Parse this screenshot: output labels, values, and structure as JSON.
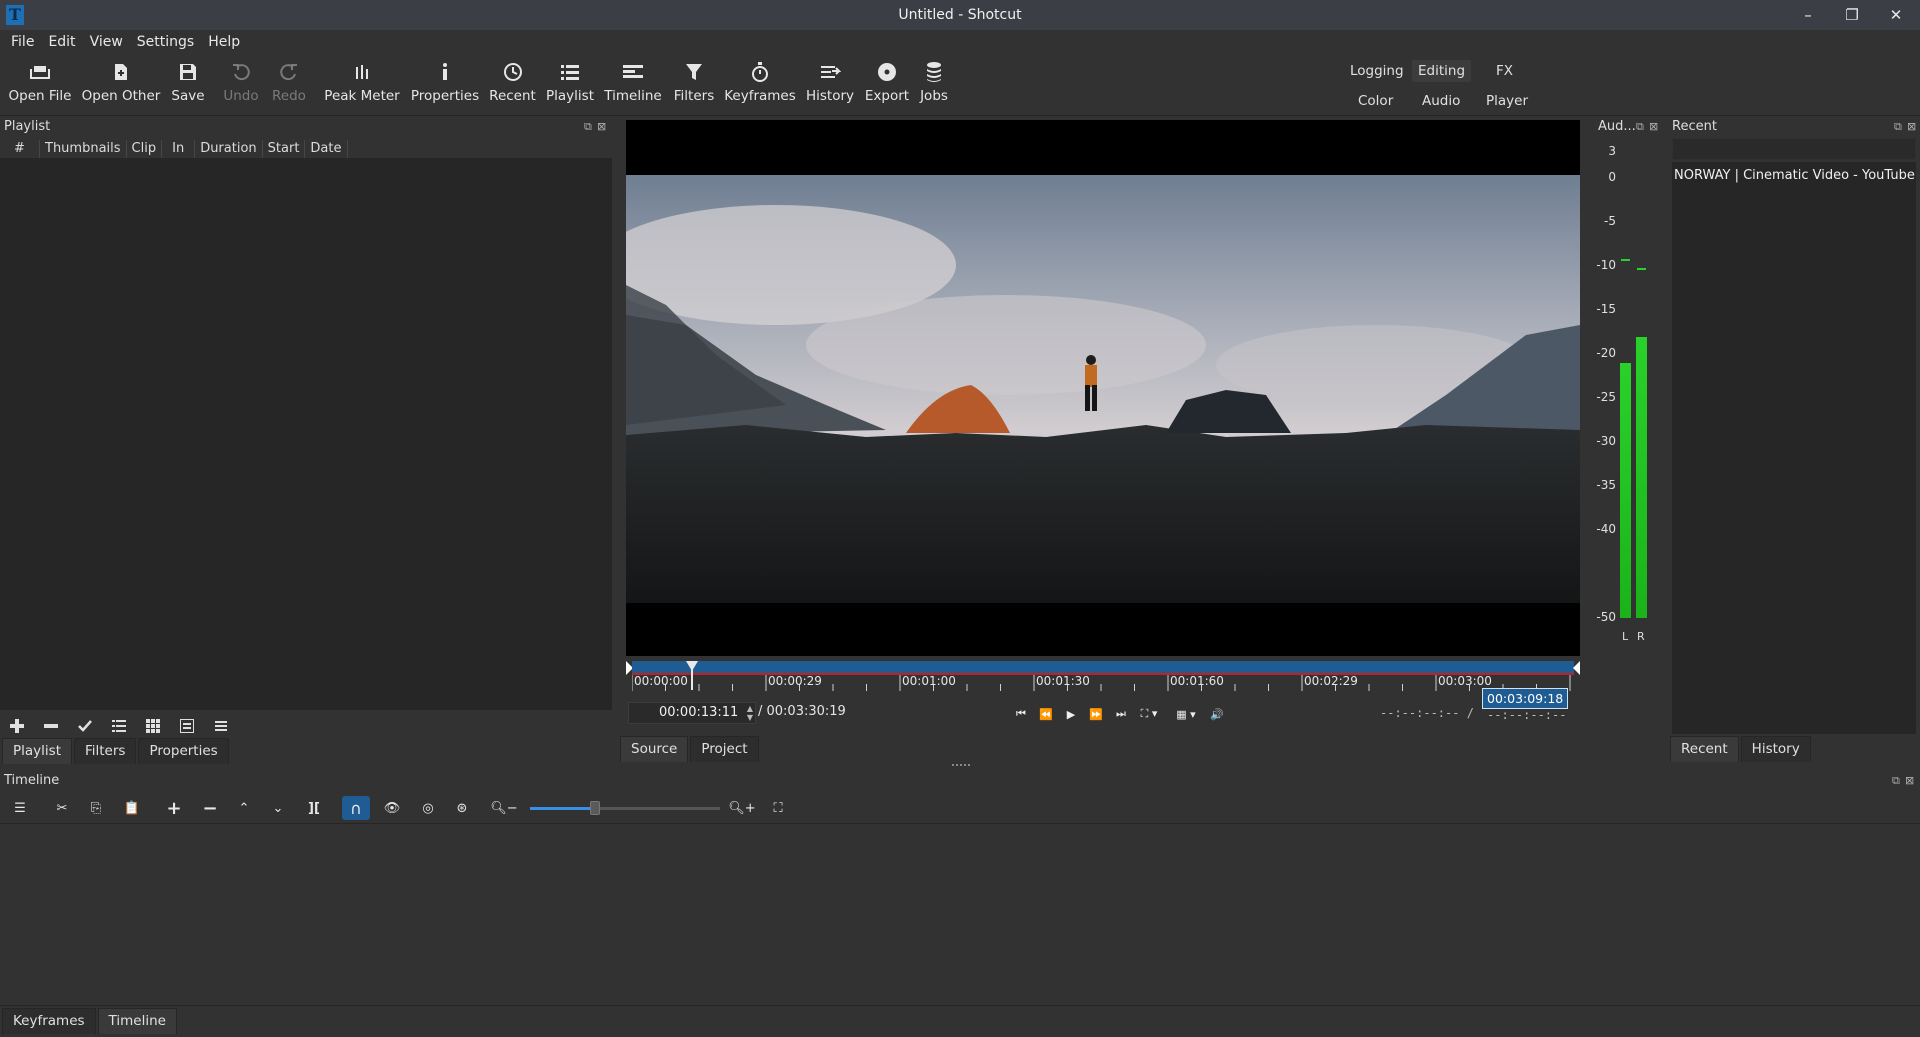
{
  "window": {
    "title": "Untitled - Shotcut",
    "app_icon_letter": "T",
    "minimize": "–",
    "maximize": "❐",
    "close": "✕"
  },
  "menu": [
    "File",
    "Edit",
    "View",
    "Settings",
    "Help"
  ],
  "toolbar": {
    "buttons": [
      {
        "label": "Open File",
        "icon": "open-file-icon"
      },
      {
        "label": "Open Other",
        "icon": "open-other-icon"
      },
      {
        "label": "Save",
        "icon": "save-icon"
      },
      {
        "label": "Undo",
        "icon": "undo-icon",
        "disabled": true
      },
      {
        "label": "Redo",
        "icon": "redo-icon",
        "disabled": true
      },
      {
        "label": "Peak Meter",
        "icon": "peak-meter-icon"
      },
      {
        "label": "Properties",
        "icon": "info-icon"
      },
      {
        "label": "Recent",
        "icon": "clock-icon"
      },
      {
        "label": "Playlist",
        "icon": "list-icon"
      },
      {
        "label": "Timeline",
        "icon": "timeline-icon"
      },
      {
        "label": "Filters",
        "icon": "filter-icon"
      },
      {
        "label": "Keyframes",
        "icon": "stopwatch-icon"
      },
      {
        "label": "History",
        "icon": "history-icon"
      },
      {
        "label": "Export",
        "icon": "disc-icon"
      },
      {
        "label": "Jobs",
        "icon": "database-icon"
      }
    ],
    "workspaces": {
      "logging": "Logging",
      "editing": "Editing",
      "fx": "FX",
      "color": "Color",
      "audio": "Audio",
      "player": "Player"
    }
  },
  "playlist": {
    "title": "Playlist",
    "columns": [
      "#",
      "Thumbnails",
      "Clip",
      "In",
      "Duration",
      "Start",
      "Date"
    ],
    "tabs": [
      "Playlist",
      "Filters",
      "Properties"
    ]
  },
  "player": {
    "timecode": "00:00:13:11",
    "duration": "/ 00:03:30:19",
    "ruler_ticks": [
      "00:00:00",
      "00:00:29",
      "00:01:00",
      "00:01:30",
      "00:01:60",
      "00:02:29",
      "00:03:00"
    ],
    "in_point": "--:--:--:-- /",
    "out_point_tooltip": "00:03:09:18",
    "out_dash": "--:--:--:--",
    "playhead_fraction": 0.064,
    "tabs": [
      "Source",
      "Project"
    ]
  },
  "audio_meter": {
    "title": "Aud...",
    "scale": [
      "3",
      "0",
      "-5",
      "-10",
      "-15",
      "-20",
      "-25",
      "-30",
      "-35",
      "-40",
      "-50"
    ],
    "channels": [
      "L",
      "R"
    ],
    "level_L": -21,
    "level_R": -18
  },
  "recent": {
    "title": "Recent",
    "items": [
      "NORWAY | Cinematic Video - YouTube..."
    ],
    "tabs": [
      "Recent",
      "History"
    ]
  },
  "timeline": {
    "title": "Timeline",
    "bottom_tabs": [
      "Keyframes",
      "Timeline"
    ]
  },
  "colors": {
    "accent": "#1f5c94",
    "meter_green": "#2ad12a",
    "playhead_red": "#c02020"
  }
}
